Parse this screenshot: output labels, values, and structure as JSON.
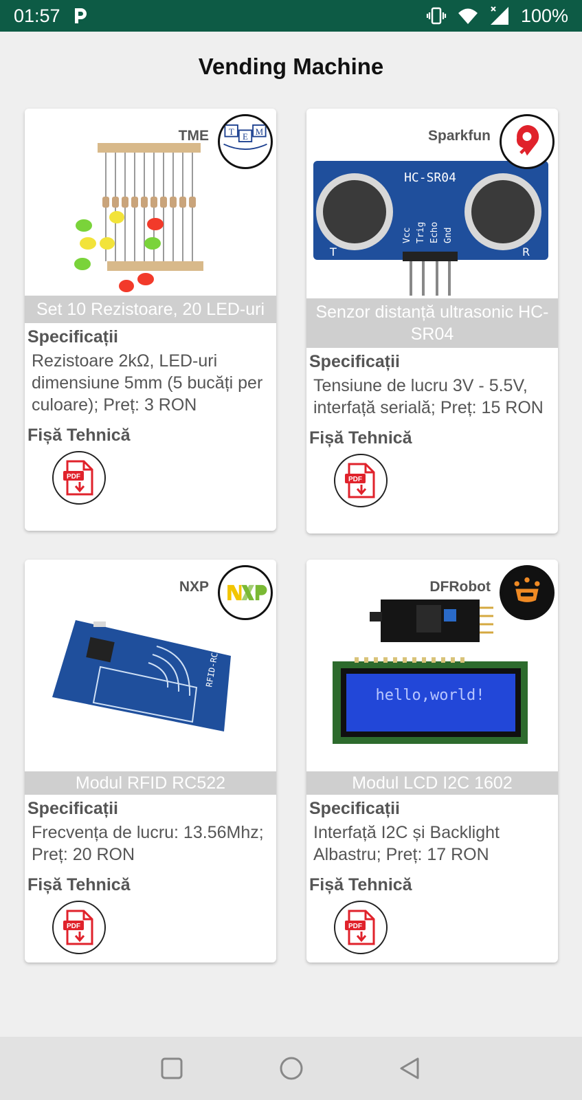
{
  "status_bar": {
    "time": "01:57",
    "battery": "100%",
    "background": "#0d5b45"
  },
  "app": {
    "title": "Vending Machine"
  },
  "products": [
    {
      "brand": "TME",
      "name": "Set 10 Rezistoare, 20 LED-uri",
      "spec_label": "Specificații",
      "spec": "Rezistoare 2kΩ, LED-uri dimensiune 5mm (5 bucăți per culoare); Preț: 3 RON",
      "datasheet_label": "Fișă Tehnică",
      "logo_text": "T M E"
    },
    {
      "brand": "Sparkfun",
      "name": "Senzor distanță ultrasonic HC-SR04",
      "spec_label": "Specificații",
      "spec": "Tensiune de lucru 3V - 5.5V, interfață serială; Preț: 15 RON",
      "datasheet_label": "Fișă Tehnică",
      "image_text": "HC-SR04",
      "pin_labels": [
        "Vcc",
        "Trig",
        "Echo",
        "Gnd"
      ],
      "side_labels": [
        "T",
        "R"
      ]
    },
    {
      "brand": "NXP",
      "name": "Modul RFID RC522",
      "spec_label": "Specificații",
      "spec": "Frecvența de lucru: 13.56Mhz; Preț: 20 RON",
      "datasheet_label": "Fișă Tehnică",
      "image_text": "RFID-RC522"
    },
    {
      "brand": "DFRobot",
      "name": "Modul LCD I2C 1602",
      "spec_label": "Specificații",
      "spec": "Interfață I2C și Backlight Albastru; Preț: 17 RON",
      "datasheet_label": "Fișă Tehnică",
      "image_text": "hello,world!"
    }
  ],
  "pdf_icon_label": "PDF",
  "colors": {
    "pdf_red": "#e0222b",
    "name_band": "#cfcfcf",
    "pcb_blue": "#1f4f9c"
  }
}
